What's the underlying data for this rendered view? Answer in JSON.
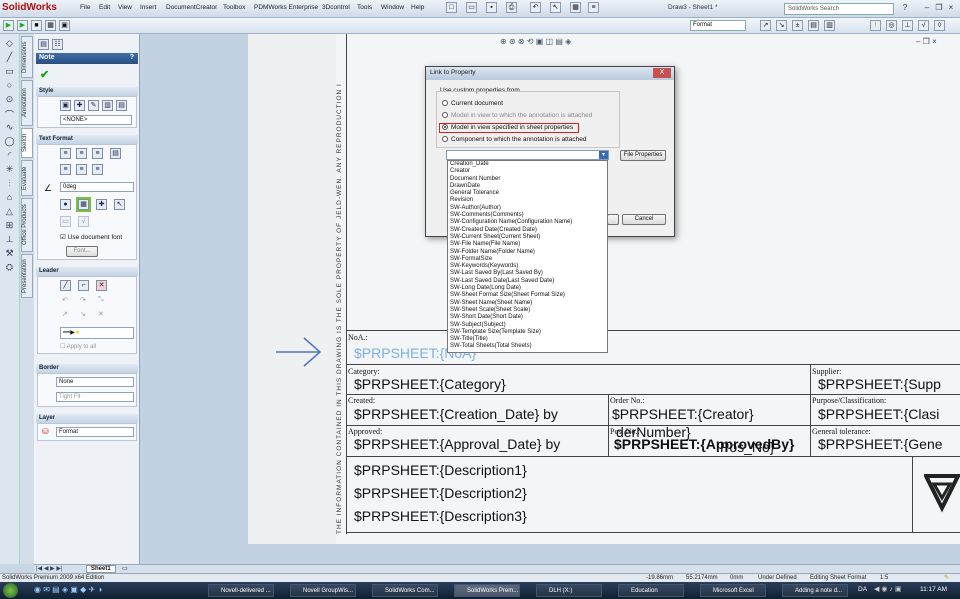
{
  "app": {
    "logo": "SolidWorks",
    "doc_title": "Draw3 - Sheet1 *",
    "search_placeholder": "SolidWorks Search",
    "format_value": "Format"
  },
  "menu": [
    "File",
    "Edit",
    "View",
    "Insert",
    "DocumentCreator",
    "Toolbox",
    "PDMWorks Enterprise",
    "3Dcontrol",
    "Tools",
    "Window",
    "Help"
  ],
  "vtabs": [
    "Dimensions",
    "Annotation",
    "Sketch",
    "Evaluate",
    "Office Products",
    "Presentation"
  ],
  "pm": {
    "title": "Note",
    "help": "?",
    "style_head": "Style",
    "style_value": "<NONE>",
    "textformat_head": "Text Format",
    "angle_value": "0deg",
    "use_doc_font": "Use document font",
    "font_btn": "Font...",
    "leader_head": "Leader",
    "apply_all": "Apply to all",
    "border_head": "Border",
    "border_value": "None",
    "border_size": "Tight Fit",
    "layer_head": "Layer",
    "layer_value": "Format"
  },
  "drawing": {
    "side_text": "THE INFORMATION CONTAINED IN THIS DRAWING IS THE SOLE PROPERTY OF JELD-WEN.  ANY REPRODUCTION I",
    "noa_label": "NoA.:",
    "noa_value": "$PRPSHEET:{NoA}",
    "category_label": "Category:",
    "category_value": "$PRPSHEET:{Category}",
    "supplier_label": "Supplier:",
    "supplier_value": "$PRPSHEET:{Supp",
    "created_label": "Created:",
    "created_value": "$PRPSHEET:{Creation_Date} by",
    "creator_value": "$PRPSHEET:{Creator}",
    "order_label": "Order No.:",
    "order_value": "derNumber}",
    "purpose_label": "Purpose/Classification:",
    "purpose_value": "$PRPSHEET:{Clasi",
    "approved_label": "Approved:",
    "approved_value": "$PRPSHEET:{Approval_Date} by",
    "approvedby_value": "$PRPSHEET:{ApprovedBy}",
    "pos_label": "Pos. No.:",
    "pos_value": "Pos_No}",
    "general_label": "General tolerance:",
    "general_value": "$PRPSHEET:{Gene",
    "desc1": "$PRPSHEET:{Description1}",
    "desc2": "$PRPSHEET:{Description2}",
    "desc3": "$PRPSHEET:{Description3}"
  },
  "dialog": {
    "title": "Link to Property",
    "group": "Use custom properties from",
    "opt1": "Current document",
    "opt2": "Model in view to which the annotation is attached",
    "opt3": "Model in view specified in sheet properties",
    "opt4": "Component to which the annotation is attached",
    "file_props": "File Properties",
    "cancel": "Cancel",
    "close": "X",
    "list": [
      "Creation_Date",
      "Creator",
      "Document Number",
      "DrawnDate",
      "General Tolerance",
      "Revision",
      "SW-Author(Author)",
      "SW-Comments(Comments)",
      "SW-Configuration Name(Configuration Name)",
      "SW-Created Date(Created Date)",
      "SW-Current Sheet(Current Sheet)",
      "SW-File Name(File Name)",
      "SW-Folder Name(Folder Name)",
      "SW-FormatSize",
      "SW-Keywords(Keywords)",
      "SW-Last Saved By(Last Saved By)",
      "SW-Last Saved Date(Last Saved Date)",
      "SW-Long Date(Long Date)",
      "SW-Sheet Format Size(Sheet Format Size)",
      "SW-Sheet Name(Sheet Name)",
      "SW-Sheet Scale(Sheet Scale)",
      "SW-Short Date(Short Date)",
      "SW-Subject(Subject)",
      "SW-Template Size(Template Size)",
      "SW-Title(Title)",
      "SW-Total Sheets(Total Sheets)"
    ]
  },
  "sheet_tab": "Sheet1",
  "status": {
    "product": "SolidWorks Premium 2009 x64 Edition",
    "x": "-19.86mm",
    "y": "55.2174mm",
    "z": "0mm",
    "state": "Under Defined",
    "mode": "Editing Sheet Format",
    "scale": "1:5"
  },
  "taskbar": {
    "items": [
      "Novell-delivered ...",
      "Novell GroupWis...",
      "SolidWorks Com...",
      "SolidWorks Prem...",
      "DLH (X:)",
      "Education",
      "Microsoft Excel",
      "Adding a note d..."
    ],
    "lang": "DA",
    "clock": "11:17 AM"
  }
}
